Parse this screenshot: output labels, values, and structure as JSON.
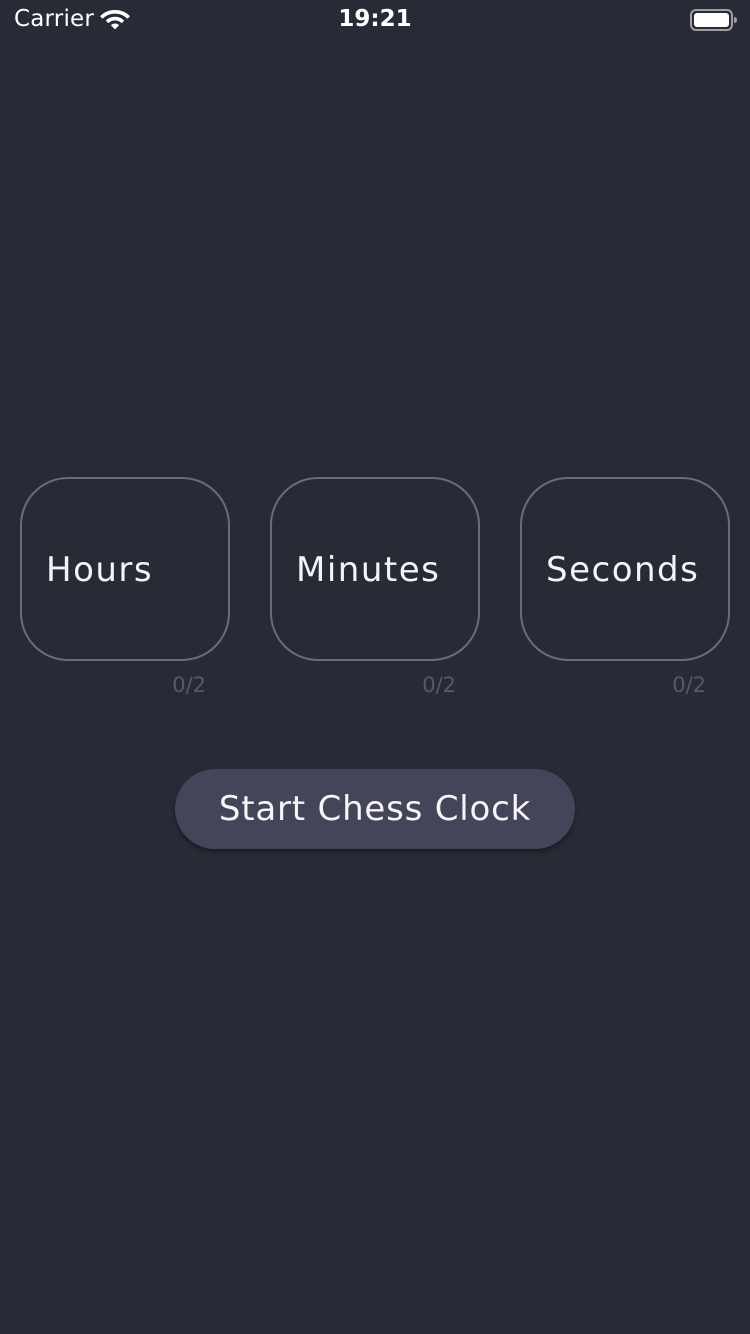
{
  "status_bar": {
    "carrier": "Carrier",
    "time": "19:21",
    "icons": [
      "wifi-icon",
      "battery-icon"
    ]
  },
  "fields": [
    {
      "label": "Hours",
      "value": "",
      "counter": "0/2"
    },
    {
      "label": "Minutes",
      "value": "",
      "counter": "0/2"
    },
    {
      "label": "Seconds",
      "value": "",
      "counter": "0/2"
    }
  ],
  "start_button": {
    "label": "Start Chess Clock"
  },
  "colors": {
    "background": "#282a36",
    "field_border": "#6e6b78",
    "counter_text": "#5a5866",
    "button_background": "#454559",
    "text": "#ffffff"
  }
}
